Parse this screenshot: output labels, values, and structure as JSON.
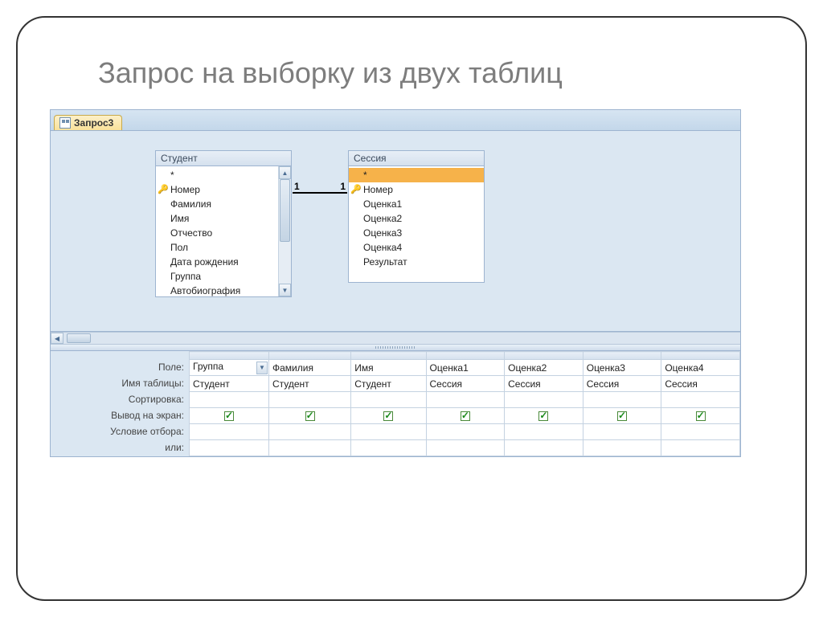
{
  "slide": {
    "title": "Запрос на выборку из двух таблиц"
  },
  "tab": {
    "label": "Запрос3"
  },
  "tables": [
    {
      "title": "Студент",
      "fields": [
        {
          "name": "*",
          "key": false,
          "selected": false
        },
        {
          "name": "Номер",
          "key": true,
          "selected": false
        },
        {
          "name": "Фамилия",
          "key": false,
          "selected": false
        },
        {
          "name": "Имя",
          "key": false,
          "selected": false
        },
        {
          "name": "Отчество",
          "key": false,
          "selected": false
        },
        {
          "name": "Пол",
          "key": false,
          "selected": false
        },
        {
          "name": "Дата рождения",
          "key": false,
          "selected": false
        },
        {
          "name": "Группа",
          "key": false,
          "selected": false
        },
        {
          "name": "Автобиография",
          "key": false,
          "selected": false
        }
      ],
      "scroll": true
    },
    {
      "title": "Сессия",
      "fields": [
        {
          "name": "*",
          "key": false,
          "selected": true
        },
        {
          "name": "Номер",
          "key": true,
          "selected": false
        },
        {
          "name": "Оценка1",
          "key": false,
          "selected": false
        },
        {
          "name": "Оценка2",
          "key": false,
          "selected": false
        },
        {
          "name": "Оценка3",
          "key": false,
          "selected": false
        },
        {
          "name": "Оценка4",
          "key": false,
          "selected": false
        },
        {
          "name": "Результат",
          "key": false,
          "selected": false
        }
      ],
      "scroll": false
    }
  ],
  "gridLabels": {
    "field": "Поле:",
    "table": "Имя таблицы:",
    "sort": "Сортировка:",
    "show": "Вывод на экран:",
    "criteria": "Условие отбора:",
    "or": "или:"
  },
  "columns": [
    {
      "field": "Группа",
      "table": "Студент",
      "show": true,
      "dropdown": true
    },
    {
      "field": "Фамилия",
      "table": "Студент",
      "show": true,
      "dropdown": false
    },
    {
      "field": "Имя",
      "table": "Студент",
      "show": true,
      "dropdown": false
    },
    {
      "field": "Оценка1",
      "table": "Сессия",
      "show": true,
      "dropdown": false
    },
    {
      "field": "Оценка2",
      "table": "Сессия",
      "show": true,
      "dropdown": false
    },
    {
      "field": "Оценка3",
      "table": "Сессия",
      "show": true,
      "dropdown": false
    },
    {
      "field": "Оценка4",
      "table": "Сессия",
      "show": true,
      "dropdown": false
    }
  ]
}
